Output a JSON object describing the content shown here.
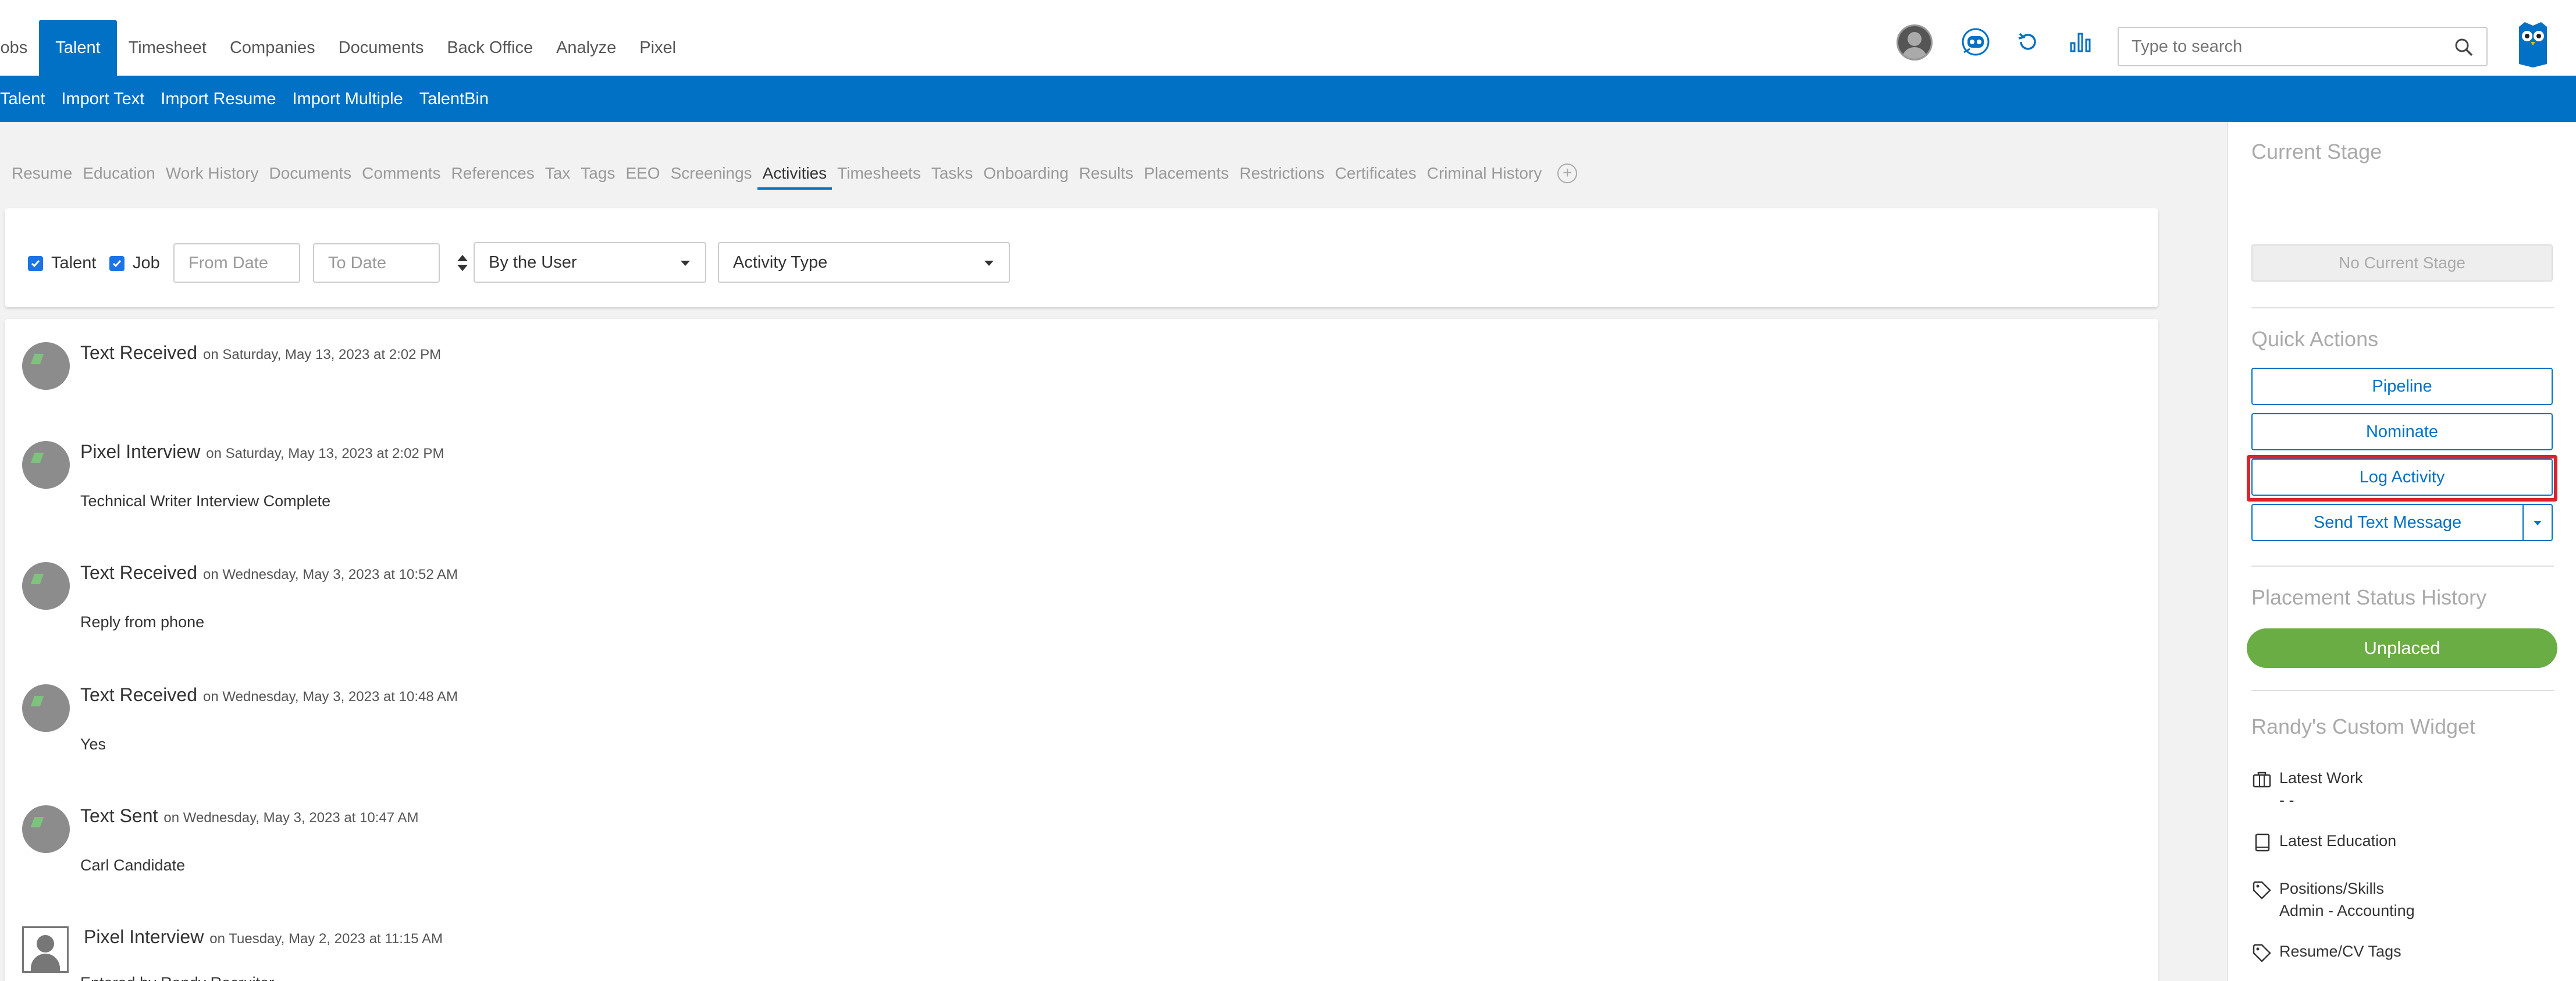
{
  "top_nav": {
    "tabs": [
      {
        "label": "Jobs",
        "active": false
      },
      {
        "label": "Talent",
        "active": true
      },
      {
        "label": "Timesheet",
        "active": false
      },
      {
        "label": "Companies",
        "active": false
      },
      {
        "label": "Documents",
        "active": false
      },
      {
        "label": "Back Office",
        "active": false
      },
      {
        "label": "Analyze",
        "active": false
      },
      {
        "label": "Pixel",
        "active": false
      }
    ],
    "search_placeholder": "Type to search"
  },
  "sub_nav": {
    "items": [
      "Talent",
      "Import Text",
      "Import Resume",
      "Import Multiple",
      "TalentBin"
    ]
  },
  "profile_tabs": [
    "Resume",
    "Education",
    "Work History",
    "Documents",
    "Comments",
    "References",
    "Tax",
    "Tags",
    "EEO",
    "Screenings",
    "Activities",
    "Timesheets",
    "Tasks",
    "Onboarding",
    "Results",
    "Placements",
    "Restrictions",
    "Certificates",
    "Criminal History"
  ],
  "active_profile_tab": "Activities",
  "filters": {
    "talent_label": "Talent",
    "talent_checked": true,
    "job_label": "Job",
    "job_checked": true,
    "from_date_placeholder": "From Date",
    "to_date_placeholder": "To Date",
    "user_select": "By the User",
    "type_select": "Activity Type"
  },
  "activities": [
    {
      "title": "Text Received",
      "date": "on Saturday, May 13, 2023 at 2:02 PM",
      "body": "",
      "avatar": "round"
    },
    {
      "title": "Pixel Interview",
      "date": "on Saturday, May 13, 2023 at 2:02 PM",
      "body": "Technical Writer Interview Complete",
      "avatar": "round"
    },
    {
      "title": "Text Received",
      "date": "on Wednesday, May 3, 2023 at 10:52 AM",
      "body": "Reply from phone",
      "avatar": "round"
    },
    {
      "title": "Text Received",
      "date": "on Wednesday, May 3, 2023 at 10:48 AM",
      "body": "Yes",
      "avatar": "round"
    },
    {
      "title": "Text Sent",
      "date": "on Wednesday, May 3, 2023 at 10:47 AM",
      "body": "Carl Candidate",
      "avatar": "round"
    },
    {
      "title": "Pixel Interview",
      "date": "on Tuesday, May 2, 2023 at 11:15 AM",
      "body": "Entered by Randy Recruiter",
      "avatar": "square"
    }
  ],
  "right_panel": {
    "current_stage_title": "Current Stage",
    "no_stage_label": "No Current Stage",
    "quick_actions_title": "Quick Actions",
    "pipeline_label": "Pipeline",
    "nominate_label": "Nominate",
    "log_activity_label": "Log Activity",
    "send_text_label": "Send Text Message",
    "placement_history_title": "Placement Status History",
    "placement_status": "Unplaced",
    "custom_widget_title": "Randy's Custom Widget",
    "latest_work_label": "Latest Work",
    "latest_work_value": "- -",
    "latest_education_label": "Latest Education",
    "positions_label": "Positions/Skills",
    "positions_value": "Admin - Accounting",
    "tags_label": "Resume/CV Tags"
  },
  "colors": {
    "brand_blue": "#0071c5",
    "placement_green": "#6aad45",
    "highlight_red": "#d9242b"
  }
}
